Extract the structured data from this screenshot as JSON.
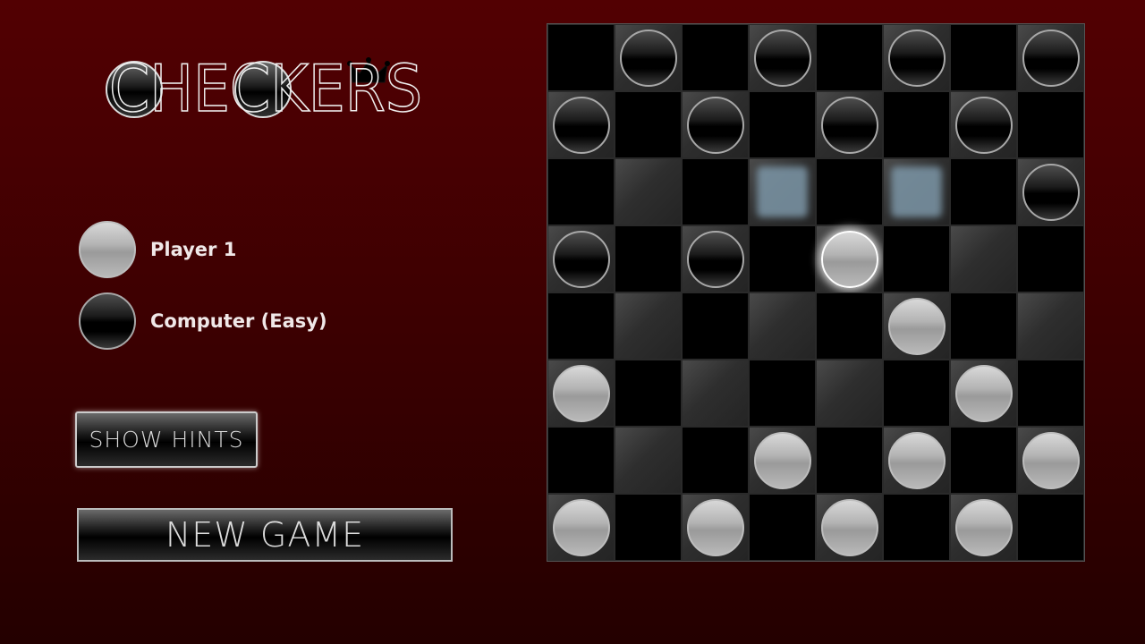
{
  "logo": {
    "text": "CHECKERS"
  },
  "players": [
    {
      "color": "white",
      "label": "Player 1"
    },
    {
      "color": "black",
      "label": "Computer (Easy)"
    }
  ],
  "buttons": {
    "show_hints": "SHOW HINTS",
    "new_game": "NEW GAME"
  },
  "board": {
    "size": 8,
    "pieces": [
      {
        "row": 0,
        "col": 1,
        "color": "black"
      },
      {
        "row": 0,
        "col": 3,
        "color": "black"
      },
      {
        "row": 0,
        "col": 5,
        "color": "black"
      },
      {
        "row": 0,
        "col": 7,
        "color": "black"
      },
      {
        "row": 1,
        "col": 0,
        "color": "black"
      },
      {
        "row": 1,
        "col": 2,
        "color": "black"
      },
      {
        "row": 1,
        "col": 4,
        "color": "black"
      },
      {
        "row": 1,
        "col": 6,
        "color": "black"
      },
      {
        "row": 2,
        "col": 7,
        "color": "black"
      },
      {
        "row": 3,
        "col": 0,
        "color": "black"
      },
      {
        "row": 3,
        "col": 2,
        "color": "black"
      },
      {
        "row": 3,
        "col": 4,
        "color": "white",
        "selected": true
      },
      {
        "row": 4,
        "col": 5,
        "color": "white"
      },
      {
        "row": 5,
        "col": 0,
        "color": "white"
      },
      {
        "row": 5,
        "col": 6,
        "color": "white"
      },
      {
        "row": 6,
        "col": 3,
        "color": "white"
      },
      {
        "row": 6,
        "col": 5,
        "color": "white"
      },
      {
        "row": 6,
        "col": 7,
        "color": "white"
      },
      {
        "row": 7,
        "col": 0,
        "color": "white"
      },
      {
        "row": 7,
        "col": 2,
        "color": "white"
      },
      {
        "row": 7,
        "col": 4,
        "color": "white"
      },
      {
        "row": 7,
        "col": 6,
        "color": "white"
      }
    ],
    "hints": [
      {
        "row": 2,
        "col": 3
      },
      {
        "row": 2,
        "col": 5
      }
    ]
  },
  "colors": {
    "background": "#4a0001",
    "hint": "#7d97a8"
  }
}
